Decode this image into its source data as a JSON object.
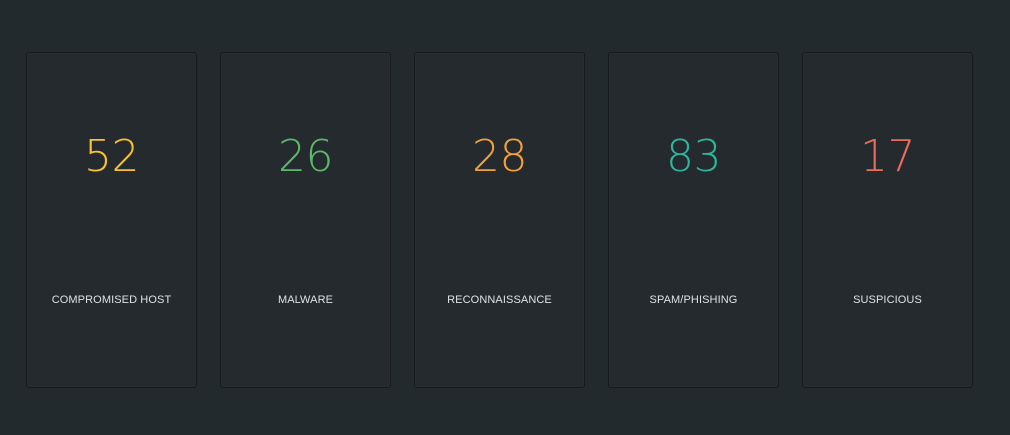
{
  "cards": [
    {
      "count": "52",
      "label": "COMPROMISED HOST",
      "color": "#f6c232"
    },
    {
      "count": "26",
      "label": "MALWARE",
      "color": "#5cb86a"
    },
    {
      "count": "28",
      "label": "RECONNAISSANCE",
      "color": "#f2a13a"
    },
    {
      "count": "83",
      "label": "SPAM/PHISHING",
      "color": "#2fb59c"
    },
    {
      "count": "17",
      "label": "SUSPICIOUS",
      "color": "#e96c5d"
    }
  ]
}
